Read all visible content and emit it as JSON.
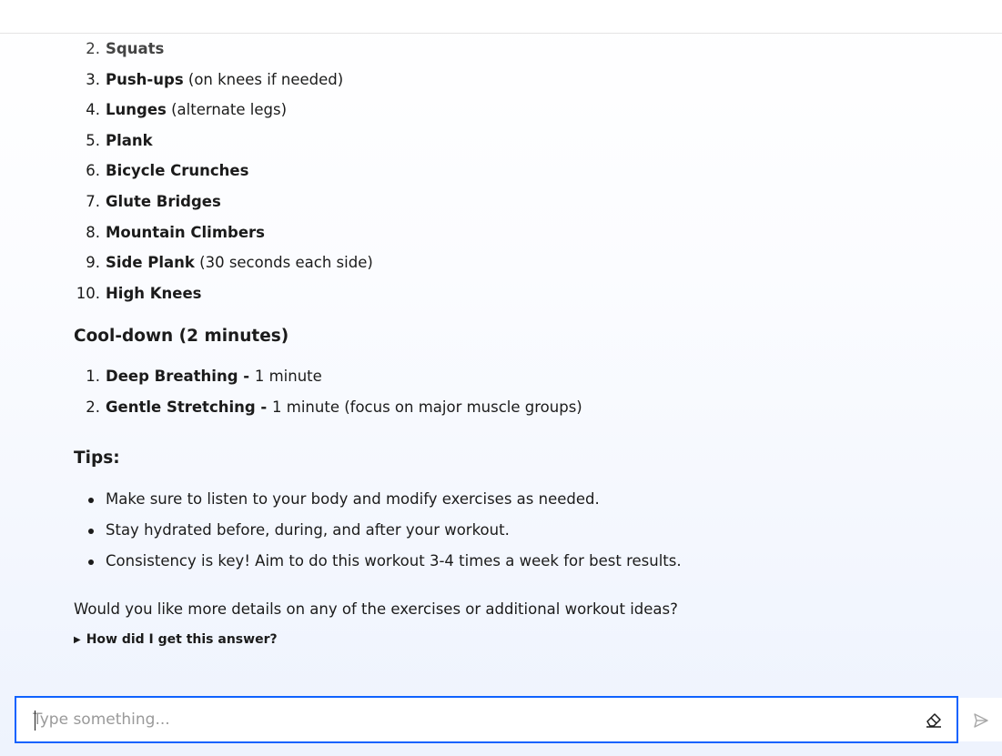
{
  "exercises_continued": [
    {
      "num": "2.",
      "name": "Squats",
      "note": ""
    },
    {
      "num": "3.",
      "name": "Push-ups",
      "note": " (on knees if needed)"
    },
    {
      "num": "4.",
      "name": "Lunges",
      "note": " (alternate legs)"
    },
    {
      "num": "5.",
      "name": "Plank",
      "note": ""
    },
    {
      "num": "6.",
      "name": "Bicycle Crunches",
      "note": ""
    },
    {
      "num": "7.",
      "name": "Glute Bridges",
      "note": ""
    },
    {
      "num": "8.",
      "name": "Mountain Climbers",
      "note": ""
    },
    {
      "num": "9.",
      "name": "Side Plank",
      "note": " (30 seconds each side)"
    },
    {
      "num": "10.",
      "name": "High Knees",
      "note": ""
    }
  ],
  "cooldown": {
    "heading": "Cool-down (2 minutes)",
    "items": [
      {
        "num": "1.",
        "name": "Deep Breathing - ",
        "note": "1 minute"
      },
      {
        "num": "2.",
        "name": "Gentle Stretching - ",
        "note": "1 minute (focus on major muscle groups)"
      }
    ]
  },
  "tips": {
    "heading": "Tips:",
    "items": [
      "Make sure to listen to your body and modify exercises as needed.",
      "Stay hydrated before, during, and after your workout.",
      "Consistency is key! Aim to do this workout 3-4 times a week for best results."
    ]
  },
  "closing": "Would you like more details on any of the exercises or additional workout ideas?",
  "details_toggle": "How did I get this answer?",
  "composer": {
    "placeholder": "Type something...",
    "value": ""
  },
  "icons": {
    "clear": "eraser-icon",
    "send": "send-icon",
    "toggle": "triangle-right-icon"
  },
  "colors": {
    "accent": "#0f62fe"
  }
}
